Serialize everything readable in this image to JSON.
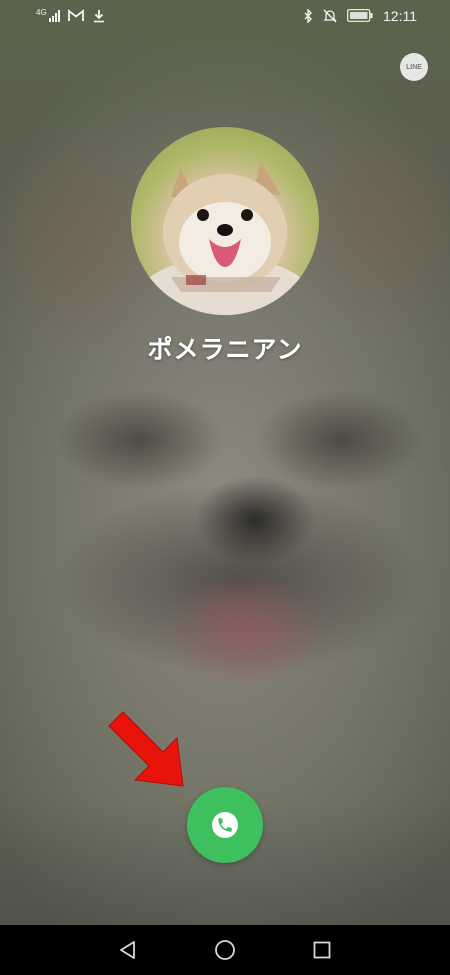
{
  "status_bar": {
    "network_label": "4G",
    "time": "12:11",
    "icons": [
      "signal-icon",
      "gmail-icon",
      "download-icon",
      "bluetooth-icon",
      "mute-icon",
      "battery-icon"
    ]
  },
  "app": {
    "badge_label": "LINE"
  },
  "call": {
    "contact_name": "ポメラニアン",
    "answer_icon": "phone-icon",
    "accent_color": "#3fc05f",
    "arrow_color": "#e8140c"
  },
  "nav_bar": {
    "icons": [
      "back-icon",
      "home-icon",
      "recents-icon"
    ]
  }
}
